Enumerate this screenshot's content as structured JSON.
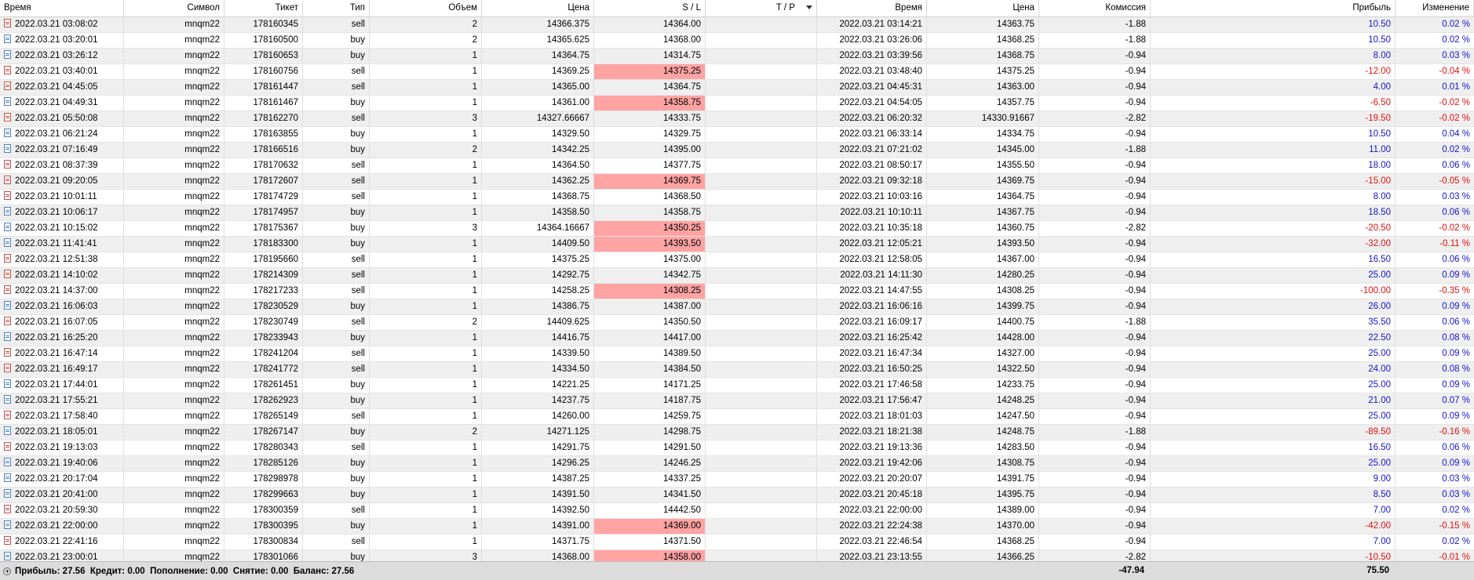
{
  "columns": [
    "Время",
    "Символ",
    "Тикет",
    "Тип",
    "Объем",
    "Цена",
    "S / L",
    "T / P",
    "Время",
    "Цена",
    "Комиссия",
    "Прибыль",
    "Изменение"
  ],
  "rows": [
    {
      "open_time": "2022.03.21 03:08:02",
      "symbol": "mnqm22",
      "ticket": "178160345",
      "type": "sell",
      "volume": "2",
      "open_price": "14366.375",
      "sl": "14364.00",
      "sl_hit": false,
      "tp": "",
      "close_time": "2022.03.21 03:14:21",
      "close_price": "14363.75",
      "commission": "-1.88",
      "profit": "10.50",
      "change": "0.02 %"
    },
    {
      "open_time": "2022.03.21 03:20:01",
      "symbol": "mnqm22",
      "ticket": "178160500",
      "type": "buy",
      "volume": "2",
      "open_price": "14365.625",
      "sl": "14368.00",
      "sl_hit": false,
      "tp": "",
      "close_time": "2022.03.21 03:26:06",
      "close_price": "14368.25",
      "commission": "-1.88",
      "profit": "10.50",
      "change": "0.02 %"
    },
    {
      "open_time": "2022.03.21 03:26:12",
      "symbol": "mnqm22",
      "ticket": "178160653",
      "type": "buy",
      "volume": "1",
      "open_price": "14364.75",
      "sl": "14314.75",
      "sl_hit": false,
      "tp": "",
      "close_time": "2022.03.21 03:39:56",
      "close_price": "14368.75",
      "commission": "-0.94",
      "profit": "8.00",
      "change": "0.03 %"
    },
    {
      "open_time": "2022.03.21 03:40:01",
      "symbol": "mnqm22",
      "ticket": "178160756",
      "type": "sell",
      "volume": "1",
      "open_price": "14369.25",
      "sl": "14375.25",
      "sl_hit": true,
      "tp": "",
      "close_time": "2022.03.21 03:48:40",
      "close_price": "14375.25",
      "commission": "-0.94",
      "profit": "-12.00",
      "change": "-0.04 %"
    },
    {
      "open_time": "2022.03.21 04:45:05",
      "symbol": "mnqm22",
      "ticket": "178161447",
      "type": "sell",
      "volume": "1",
      "open_price": "14365.00",
      "sl": "14364.75",
      "sl_hit": false,
      "tp": "",
      "close_time": "2022.03.21 04:45:31",
      "close_price": "14363.00",
      "commission": "-0.94",
      "profit": "4.00",
      "change": "0.01 %"
    },
    {
      "open_time": "2022.03.21 04:49:31",
      "symbol": "mnqm22",
      "ticket": "178161467",
      "type": "buy",
      "volume": "1",
      "open_price": "14361.00",
      "sl": "14358.75",
      "sl_hit": true,
      "tp": "",
      "close_time": "2022.03.21 04:54:05",
      "close_price": "14357.75",
      "commission": "-0.94",
      "profit": "-6.50",
      "change": "-0.02 %"
    },
    {
      "open_time": "2022.03.21 05:50:08",
      "symbol": "mnqm22",
      "ticket": "178162270",
      "type": "sell",
      "volume": "3",
      "open_price": "14327.66667",
      "sl": "14333.75",
      "sl_hit": false,
      "tp": "",
      "close_time": "2022.03.21 06:20:32",
      "close_price": "14330.91667",
      "commission": "-2.82",
      "profit": "-19.50",
      "change": "-0.02 %"
    },
    {
      "open_time": "2022.03.21 06:21:24",
      "symbol": "mnqm22",
      "ticket": "178163855",
      "type": "buy",
      "volume": "1",
      "open_price": "14329.50",
      "sl": "14329.75",
      "sl_hit": false,
      "tp": "",
      "close_time": "2022.03.21 06:33:14",
      "close_price": "14334.75",
      "commission": "-0.94",
      "profit": "10.50",
      "change": "0.04 %"
    },
    {
      "open_time": "2022.03.21 07:16:49",
      "symbol": "mnqm22",
      "ticket": "178166516",
      "type": "buy",
      "volume": "2",
      "open_price": "14342.25",
      "sl": "14395.00",
      "sl_hit": false,
      "tp": "",
      "close_time": "2022.03.21 07:21:02",
      "close_price": "14345.00",
      "commission": "-1.88",
      "profit": "11.00",
      "change": "0.02 %"
    },
    {
      "open_time": "2022.03.21 08:37:39",
      "symbol": "mnqm22",
      "ticket": "178170632",
      "type": "sell",
      "volume": "1",
      "open_price": "14364.50",
      "sl": "14377.75",
      "sl_hit": false,
      "tp": "",
      "close_time": "2022.03.21 08:50:17",
      "close_price": "14355.50",
      "commission": "-0.94",
      "profit": "18.00",
      "change": "0.06 %"
    },
    {
      "open_time": "2022.03.21 09:20:05",
      "symbol": "mnqm22",
      "ticket": "178172607",
      "type": "sell",
      "volume": "1",
      "open_price": "14362.25",
      "sl": "14369.75",
      "sl_hit": true,
      "tp": "",
      "close_time": "2022.03.21 09:32:18",
      "close_price": "14369.75",
      "commission": "-0.94",
      "profit": "-15.00",
      "change": "-0.05 %"
    },
    {
      "open_time": "2022.03.21 10:01:11",
      "symbol": "mnqm22",
      "ticket": "178174729",
      "type": "sell",
      "volume": "1",
      "open_price": "14368.75",
      "sl": "14368.50",
      "sl_hit": false,
      "tp": "",
      "close_time": "2022.03.21 10:03:16",
      "close_price": "14364.75",
      "commission": "-0.94",
      "profit": "8.00",
      "change": "0.03 %"
    },
    {
      "open_time": "2022.03.21 10:06:17",
      "symbol": "mnqm22",
      "ticket": "178174957",
      "type": "buy",
      "volume": "1",
      "open_price": "14358.50",
      "sl": "14358.75",
      "sl_hit": false,
      "tp": "",
      "close_time": "2022.03.21 10:10:11",
      "close_price": "14367.75",
      "commission": "-0.94",
      "profit": "18.50",
      "change": "0.06 %"
    },
    {
      "open_time": "2022.03.21 10:15:02",
      "symbol": "mnqm22",
      "ticket": "178175367",
      "type": "buy",
      "volume": "3",
      "open_price": "14364.16667",
      "sl": "14350.25",
      "sl_hit": true,
      "tp": "",
      "close_time": "2022.03.21 10:35:18",
      "close_price": "14360.75",
      "commission": "-2.82",
      "profit": "-20.50",
      "change": "-0.02 %"
    },
    {
      "open_time": "2022.03.21 11:41:41",
      "symbol": "mnqm22",
      "ticket": "178183300",
      "type": "buy",
      "volume": "1",
      "open_price": "14409.50",
      "sl": "14393.50",
      "sl_hit": true,
      "tp": "",
      "close_time": "2022.03.21 12:05:21",
      "close_price": "14393.50",
      "commission": "-0.94",
      "profit": "-32.00",
      "change": "-0.11 %"
    },
    {
      "open_time": "2022.03.21 12:51:38",
      "symbol": "mnqm22",
      "ticket": "178195660",
      "type": "sell",
      "volume": "1",
      "open_price": "14375.25",
      "sl": "14375.00",
      "sl_hit": false,
      "tp": "",
      "close_time": "2022.03.21 12:58:05",
      "close_price": "14367.00",
      "commission": "-0.94",
      "profit": "16.50",
      "change": "0.06 %"
    },
    {
      "open_time": "2022.03.21 14:10:02",
      "symbol": "mnqm22",
      "ticket": "178214309",
      "type": "sell",
      "volume": "1",
      "open_price": "14292.75",
      "sl": "14342.75",
      "sl_hit": false,
      "tp": "",
      "close_time": "2022.03.21 14:11:30",
      "close_price": "14280.25",
      "commission": "-0.94",
      "profit": "25.00",
      "change": "0.09 %"
    },
    {
      "open_time": "2022.03.21 14:37:00",
      "symbol": "mnqm22",
      "ticket": "178217233",
      "type": "sell",
      "volume": "1",
      "open_price": "14258.25",
      "sl": "14308.25",
      "sl_hit": true,
      "tp": "",
      "close_time": "2022.03.21 14:47:55",
      "close_price": "14308.25",
      "commission": "-0.94",
      "profit": "-100.00",
      "change": "-0.35 %"
    },
    {
      "open_time": "2022.03.21 16:06:03",
      "symbol": "mnqm22",
      "ticket": "178230529",
      "type": "buy",
      "volume": "1",
      "open_price": "14386.75",
      "sl": "14387.00",
      "sl_hit": false,
      "tp": "",
      "close_time": "2022.03.21 16:06:16",
      "close_price": "14399.75",
      "commission": "-0.94",
      "profit": "26.00",
      "change": "0.09 %"
    },
    {
      "open_time": "2022.03.21 16:07:05",
      "symbol": "mnqm22",
      "ticket": "178230749",
      "type": "sell",
      "volume": "2",
      "open_price": "14409.625",
      "sl": "14350.50",
      "sl_hit": false,
      "tp": "",
      "close_time": "2022.03.21 16:09:17",
      "close_price": "14400.75",
      "commission": "-1.88",
      "profit": "35.50",
      "change": "0.06 %"
    },
    {
      "open_time": "2022.03.21 16:25:20",
      "symbol": "mnqm22",
      "ticket": "178233943",
      "type": "buy",
      "volume": "1",
      "open_price": "14416.75",
      "sl": "14417.00",
      "sl_hit": false,
      "tp": "",
      "close_time": "2022.03.21 16:25:42",
      "close_price": "14428.00",
      "commission": "-0.94",
      "profit": "22.50",
      "change": "0.08 %"
    },
    {
      "open_time": "2022.03.21 16:47:14",
      "symbol": "mnqm22",
      "ticket": "178241204",
      "type": "sell",
      "volume": "1",
      "open_price": "14339.50",
      "sl": "14389.50",
      "sl_hit": false,
      "tp": "",
      "close_time": "2022.03.21 16:47:34",
      "close_price": "14327.00",
      "commission": "-0.94",
      "profit": "25.00",
      "change": "0.09 %"
    },
    {
      "open_time": "2022.03.21 16:49:17",
      "symbol": "mnqm22",
      "ticket": "178241772",
      "type": "sell",
      "volume": "1",
      "open_price": "14334.50",
      "sl": "14384.50",
      "sl_hit": false,
      "tp": "",
      "close_time": "2022.03.21 16:50:25",
      "close_price": "14322.50",
      "commission": "-0.94",
      "profit": "24.00",
      "change": "0.08 %"
    },
    {
      "open_time": "2022.03.21 17:44:01",
      "symbol": "mnqm22",
      "ticket": "178261451",
      "type": "buy",
      "volume": "1",
      "open_price": "14221.25",
      "sl": "14171.25",
      "sl_hit": false,
      "tp": "",
      "close_time": "2022.03.21 17:46:58",
      "close_price": "14233.75",
      "commission": "-0.94",
      "profit": "25.00",
      "change": "0.09 %"
    },
    {
      "open_time": "2022.03.21 17:55:21",
      "symbol": "mnqm22",
      "ticket": "178262923",
      "type": "buy",
      "volume": "1",
      "open_price": "14237.75",
      "sl": "14187.75",
      "sl_hit": false,
      "tp": "",
      "close_time": "2022.03.21 17:56:47",
      "close_price": "14248.25",
      "commission": "-0.94",
      "profit": "21.00",
      "change": "0.07 %"
    },
    {
      "open_time": "2022.03.21 17:58:40",
      "symbol": "mnqm22",
      "ticket": "178265149",
      "type": "sell",
      "volume": "1",
      "open_price": "14260.00",
      "sl": "14259.75",
      "sl_hit": false,
      "tp": "",
      "close_time": "2022.03.21 18:01:03",
      "close_price": "14247.50",
      "commission": "-0.94",
      "profit": "25.00",
      "change": "0.09 %"
    },
    {
      "open_time": "2022.03.21 18:05:01",
      "symbol": "mnqm22",
      "ticket": "178267147",
      "type": "buy",
      "volume": "2",
      "open_price": "14271.125",
      "sl": "14298.75",
      "sl_hit": false,
      "tp": "",
      "close_time": "2022.03.21 18:21:38",
      "close_price": "14248.75",
      "commission": "-1.88",
      "profit": "-89.50",
      "change": "-0.16 %"
    },
    {
      "open_time": "2022.03.21 19:13:03",
      "symbol": "mnqm22",
      "ticket": "178280343",
      "type": "sell",
      "volume": "1",
      "open_price": "14291.75",
      "sl": "14291.50",
      "sl_hit": false,
      "tp": "",
      "close_time": "2022.03.21 19:13:36",
      "close_price": "14283.50",
      "commission": "-0.94",
      "profit": "16.50",
      "change": "0.06 %"
    },
    {
      "open_time": "2022.03.21 19:40:06",
      "symbol": "mnqm22",
      "ticket": "178285126",
      "type": "buy",
      "volume": "1",
      "open_price": "14296.25",
      "sl": "14246.25",
      "sl_hit": false,
      "tp": "",
      "close_time": "2022.03.21 19:42:06",
      "close_price": "14308.75",
      "commission": "-0.94",
      "profit": "25.00",
      "change": "0.09 %"
    },
    {
      "open_time": "2022.03.21 20:17:04",
      "symbol": "mnqm22",
      "ticket": "178298978",
      "type": "buy",
      "volume": "1",
      "open_price": "14387.25",
      "sl": "14337.25",
      "sl_hit": false,
      "tp": "",
      "close_time": "2022.03.21 20:20:07",
      "close_price": "14391.75",
      "commission": "-0.94",
      "profit": "9.00",
      "change": "0.03 %"
    },
    {
      "open_time": "2022.03.21 20:41:00",
      "symbol": "mnqm22",
      "ticket": "178299663",
      "type": "buy",
      "volume": "1",
      "open_price": "14391.50",
      "sl": "14341.50",
      "sl_hit": false,
      "tp": "",
      "close_time": "2022.03.21 20:45:18",
      "close_price": "14395.75",
      "commission": "-0.94",
      "profit": "8.50",
      "change": "0.03 %"
    },
    {
      "open_time": "2022.03.21 20:59:30",
      "symbol": "mnqm22",
      "ticket": "178300359",
      "type": "sell",
      "volume": "1",
      "open_price": "14392.50",
      "sl": "14442.50",
      "sl_hit": false,
      "tp": "",
      "close_time": "2022.03.21 22:00:00",
      "close_price": "14389.00",
      "commission": "-0.94",
      "profit": "7.00",
      "change": "0.02 %"
    },
    {
      "open_time": "2022.03.21 22:00:00",
      "symbol": "mnqm22",
      "ticket": "178300395",
      "type": "buy",
      "volume": "1",
      "open_price": "14391.00",
      "sl": "14369.00",
      "sl_hit": true,
      "tp": "",
      "close_time": "2022.03.21 22:24:38",
      "close_price": "14370.00",
      "commission": "-0.94",
      "profit": "-42.00",
      "change": "-0.15 %"
    },
    {
      "open_time": "2022.03.21 22:41:16",
      "symbol": "mnqm22",
      "ticket": "178300834",
      "type": "sell",
      "volume": "1",
      "open_price": "14371.75",
      "sl": "14371.50",
      "sl_hit": false,
      "tp": "",
      "close_time": "2022.03.21 22:46:54",
      "close_price": "14368.25",
      "commission": "-0.94",
      "profit": "7.00",
      "change": "0.02 %"
    },
    {
      "open_time": "2022.03.21 23:00:01",
      "symbol": "mnqm22",
      "ticket": "178301066",
      "type": "buy",
      "volume": "3",
      "open_price": "14368.00",
      "sl": "14358.00",
      "sl_hit": true,
      "tp": "",
      "close_time": "2022.03.21 23:13:55",
      "close_price": "14366.25",
      "commission": "-2.82",
      "profit": "-10.50",
      "change": "-0.01 %"
    }
  ],
  "footer": {
    "summary": "Прибыль: 27.56  Кредит: 0.00  Пополнение: 0.00  Снятие: 0.00  Баланс: 27.56",
    "total_commission": "-47.94",
    "total_profit": "75.50"
  },
  "colors": {
    "positive": "#1515c8",
    "negative": "#e01010",
    "sl_hit_bg": "#ffa3a3",
    "alt_row": "#efefef",
    "footer_bg": "#dcdcdc"
  },
  "icons": {
    "sell_row": "document-red-icon",
    "buy_row": "document-blue-icon",
    "expand": "plus-circle-icon",
    "sort": "sort-down-arrow-icon"
  }
}
